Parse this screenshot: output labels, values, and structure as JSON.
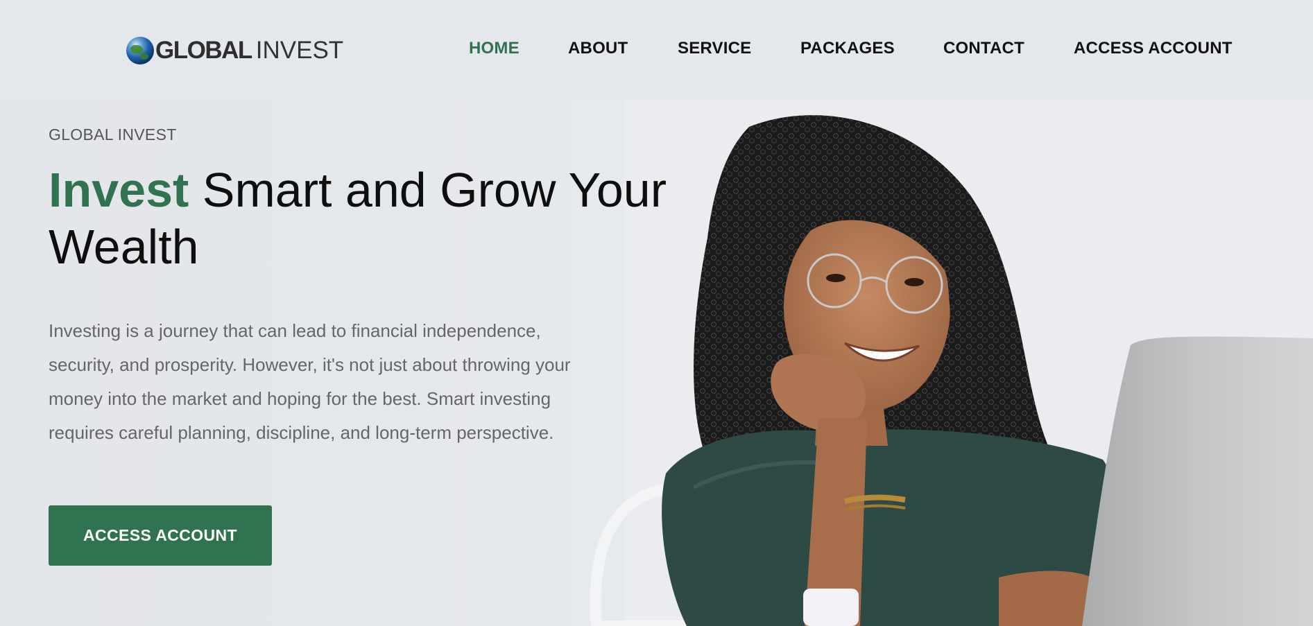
{
  "brand": {
    "logo_bold": "GLOBAL",
    "logo_light": "INVEST",
    "accent_color": "#2f7350"
  },
  "nav": {
    "items": [
      {
        "label": "HOME",
        "active": true
      },
      {
        "label": "ABOUT"
      },
      {
        "label": "SERVICE"
      },
      {
        "label": "PACKAGES"
      },
      {
        "label": "CONTACT"
      },
      {
        "label": "ACCESS ACCOUNT"
      }
    ]
  },
  "hero": {
    "eyebrow": "GLOBAL INVEST",
    "headline_accent": "Invest",
    "headline_rest": "Smart and Grow Your Wealth",
    "lead": "Investing is a journey that can lead to financial independence, security, and prosperity. However, it's not just about throwing your money into the market and hoping for the best. Smart investing requires careful planning, discipline, and long-term perspective.",
    "cta_label": "ACCESS ACCOUNT",
    "image": "woman-with-laptop-photo"
  }
}
